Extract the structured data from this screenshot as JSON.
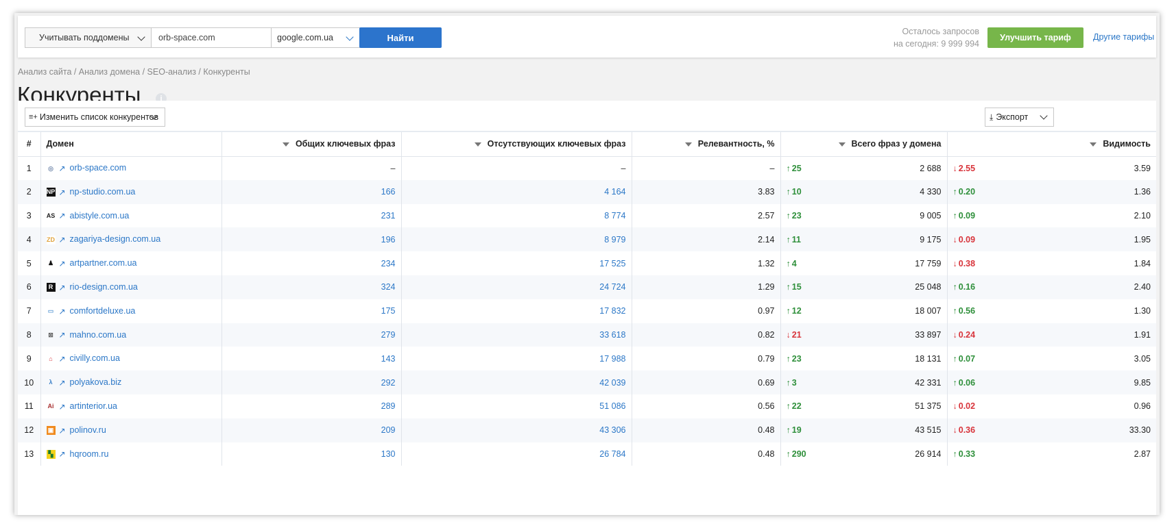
{
  "toolbar": {
    "subdomain_label": "Учитывать поддомены",
    "domain_value": "orb-space.com",
    "engine_value": "google.com.ua",
    "find_label": "Найти",
    "quota_line1": "Осталось запросов",
    "quota_line2": "на сегодня: 9 999 994",
    "upgrade_label": "Улучшить тариф",
    "tariffs_label": "Другие тарифы"
  },
  "breadcrumb": "Анализ сайта / Анализ домена / SEO-анализ / Конкуренты",
  "page_title": "Конкуренты",
  "panel": {
    "change_list_label": "Изменить список конкурентов",
    "export_label": "Экспорт"
  },
  "columns": {
    "num": "#",
    "domain": "Домен",
    "common": "Общих ключевых фраз",
    "missing": "Отсутствующих ключевых фраз",
    "relevance": "Релевантность, %",
    "total": "Всего фраз у домена",
    "visibility": "Видимость"
  },
  "colors": {
    "accent": "#2c74cc",
    "link": "#2b77c7",
    "green": "#77b64a",
    "up": "#2e8f3a",
    "down": "#d8343b"
  },
  "rows": [
    {
      "n": "1",
      "domain": "orb-space.com",
      "icon": "globe-icon",
      "common": "–",
      "missing": "–",
      "rel": "–",
      "total_delta": "25",
      "total_dir": "up",
      "total": "2 688",
      "vis_delta": "2.55",
      "vis_dir": "down",
      "vis": "3.59"
    },
    {
      "n": "2",
      "domain": "np-studio.com.ua",
      "icon": "np-logo-icon",
      "common": "166",
      "missing": "4 164",
      "rel": "3.83",
      "total_delta": "10",
      "total_dir": "up",
      "total": "4 330",
      "vis_delta": "0.20",
      "vis_dir": "up",
      "vis": "1.36"
    },
    {
      "n": "3",
      "domain": "abistyle.com.ua",
      "icon": "as-logo-icon",
      "common": "231",
      "missing": "8 774",
      "rel": "2.57",
      "total_delta": "23",
      "total_dir": "up",
      "total": "9 005",
      "vis_delta": "0.09",
      "vis_dir": "up",
      "vis": "2.10"
    },
    {
      "n": "4",
      "domain": "zagariya-design.com.ua",
      "icon": "zd-logo-icon",
      "common": "196",
      "missing": "8 979",
      "rel": "2.14",
      "total_delta": "11",
      "total_dir": "up",
      "total": "9 175",
      "vis_delta": "0.09",
      "vis_dir": "down",
      "vis": "1.95"
    },
    {
      "n": "5",
      "domain": "artpartner.com.ua",
      "icon": "pen-logo-icon",
      "common": "234",
      "missing": "17 525",
      "rel": "1.32",
      "total_delta": "4",
      "total_dir": "up",
      "total": "17 759",
      "vis_delta": "0.38",
      "vis_dir": "down",
      "vis": "1.84"
    },
    {
      "n": "6",
      "domain": "rio-design.com.ua",
      "icon": "r-logo-icon",
      "common": "324",
      "missing": "24 724",
      "rel": "1.29",
      "total_delta": "15",
      "total_dir": "up",
      "total": "25 048",
      "vis_delta": "0.16",
      "vis_dir": "up",
      "vis": "2.40"
    },
    {
      "n": "7",
      "domain": "comfortdeluxe.ua",
      "icon": "cd-logo-icon",
      "common": "175",
      "missing": "17 832",
      "rel": "0.97",
      "total_delta": "12",
      "total_dir": "up",
      "total": "18 007",
      "vis_delta": "0.56",
      "vis_dir": "up",
      "vis": "1.30"
    },
    {
      "n": "8",
      "domain": "mahno.com.ua",
      "icon": "m-logo-icon",
      "common": "279",
      "missing": "33 618",
      "rel": "0.82",
      "total_delta": "21",
      "total_dir": "down",
      "total": "33 897",
      "vis_delta": "0.24",
      "vis_dir": "down",
      "vis": "1.91"
    },
    {
      "n": "9",
      "domain": "civilly.com.ua",
      "icon": "house-logo-icon",
      "common": "143",
      "missing": "17 988",
      "rel": "0.79",
      "total_delta": "23",
      "total_dir": "up",
      "total": "18 131",
      "vis_delta": "0.07",
      "vis_dir": "up",
      "vis": "3.05"
    },
    {
      "n": "10",
      "domain": "polyakova.biz",
      "icon": "lambda-logo-icon",
      "common": "292",
      "missing": "42 039",
      "rel": "0.69",
      "total_delta": "3",
      "total_dir": "up",
      "total": "42 331",
      "vis_delta": "0.06",
      "vis_dir": "up",
      "vis": "9.85"
    },
    {
      "n": "11",
      "domain": "artinterior.ua",
      "icon": "ai-logo-icon",
      "common": "289",
      "missing": "51 086",
      "rel": "0.56",
      "total_delta": "22",
      "total_dir": "up",
      "total": "51 375",
      "vis_delta": "0.02",
      "vis_dir": "down",
      "vis": "0.96"
    },
    {
      "n": "12",
      "domain": "polinov.ru",
      "icon": "p-logo-icon",
      "common": "209",
      "missing": "43 306",
      "rel": "0.48",
      "total_delta": "19",
      "total_dir": "up",
      "total": "43 515",
      "vis_delta": "0.36",
      "vis_dir": "down",
      "vis": "33.30"
    },
    {
      "n": "13",
      "domain": "hqroom.ru",
      "icon": "hq-logo-icon",
      "common": "130",
      "missing": "26 784",
      "rel": "0.48",
      "total_delta": "290",
      "total_dir": "up",
      "total": "26 914",
      "vis_delta": "0.33",
      "vis_dir": "up",
      "vis": "2.87"
    }
  ]
}
